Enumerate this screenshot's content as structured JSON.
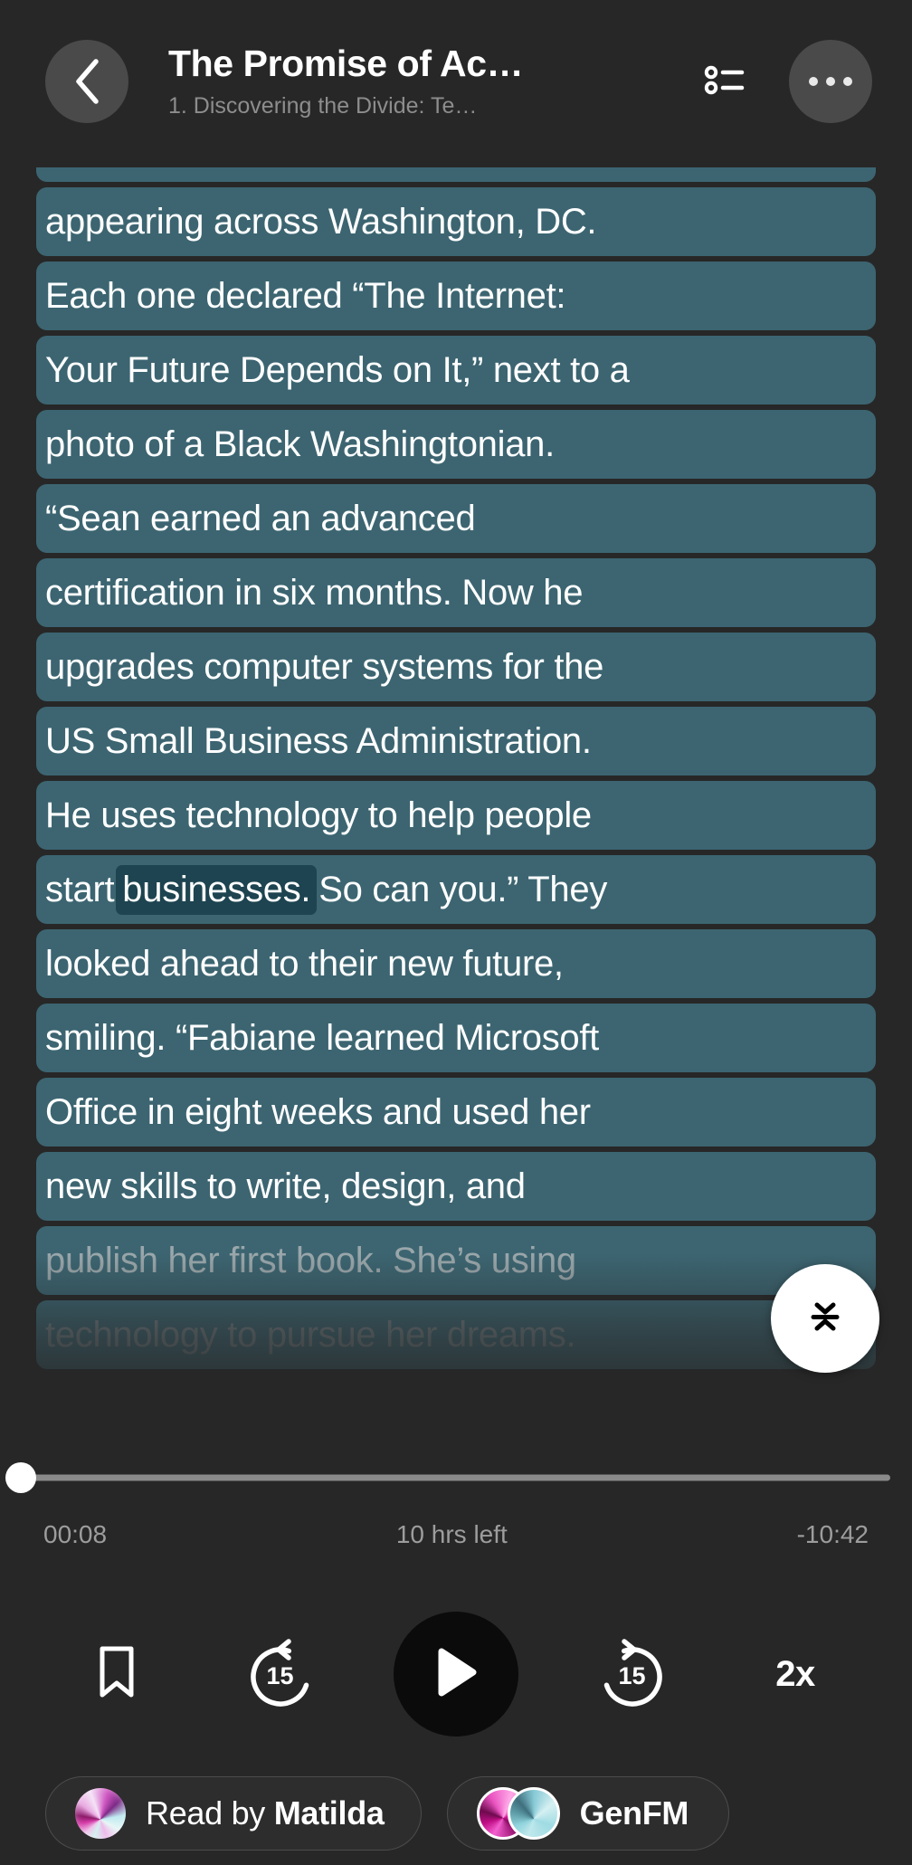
{
  "header": {
    "back_icon": "chevron-left-icon",
    "title": "The Promise of Ac…",
    "subtitle": "1. Discovering the Divide: Te…",
    "chapters_icon": "chapter-list-icon",
    "more_icon": "more-options-icon"
  },
  "transcript": {
    "collapse_icon": "collapse-icon",
    "lines": [
      {
        "text": "appearing across Washington, DC.",
        "state": "read"
      },
      {
        "text": "Each one declared “The Internet:",
        "state": "read"
      },
      {
        "text": "Your Future Depends on It,” next to a",
        "state": "read"
      },
      {
        "text": "photo of a Black Washingtonian.",
        "state": "read"
      },
      {
        "text": "“Sean earned an advanced",
        "state": "read"
      },
      {
        "text": "certification in six months. Now he",
        "state": "read"
      },
      {
        "text": "upgrades computer systems for the",
        "state": "read"
      },
      {
        "text": "US Small Business Administration.",
        "state": "read"
      },
      {
        "text": "He uses technology to help people",
        "state": "read"
      },
      {
        "text": "",
        "state": "current",
        "segments": [
          {
            "text": "start ",
            "active": false
          },
          {
            "text": "businesses.",
            "active": true
          },
          {
            "text": " So can you.” They",
            "active": false
          }
        ]
      },
      {
        "text": "looked ahead to their new future,",
        "state": "read"
      },
      {
        "text": "smiling. “Fabiane learned Microsoft",
        "state": "read"
      },
      {
        "text": "Office in eight weeks and used her",
        "state": "read"
      },
      {
        "text": "new skills to write, design, and",
        "state": "read"
      },
      {
        "text": "publish her first book. She’s using",
        "state": "dim"
      },
      {
        "text": "technology to pursue her dreams.",
        "state": "dim2"
      }
    ]
  },
  "player": {
    "progress_percent": 0,
    "elapsed": "00:08",
    "remaining_label": "10 hrs left",
    "time_left": "-10:42",
    "bookmark_icon": "bookmark-icon",
    "rewind_icon": "rewind-15-icon",
    "rewind_seconds": "15",
    "play_icon": "play-icon",
    "forward_icon": "forward-15-icon",
    "forward_seconds": "15",
    "speed": "2x"
  },
  "pills": {
    "reader_prefix": "Read by ",
    "reader_name": "Matilda",
    "reader_orb_icon": "voice-orb-icon",
    "genfm_label": "GenFM",
    "genfm_orb_icon": "genfm-duo-orb-icon"
  },
  "colors": {
    "background": "#272727",
    "highlight": "#3c6571",
    "active_word": "#1d4450",
    "accent_white": "#ffffff",
    "muted_text": "#9d9d9d"
  }
}
